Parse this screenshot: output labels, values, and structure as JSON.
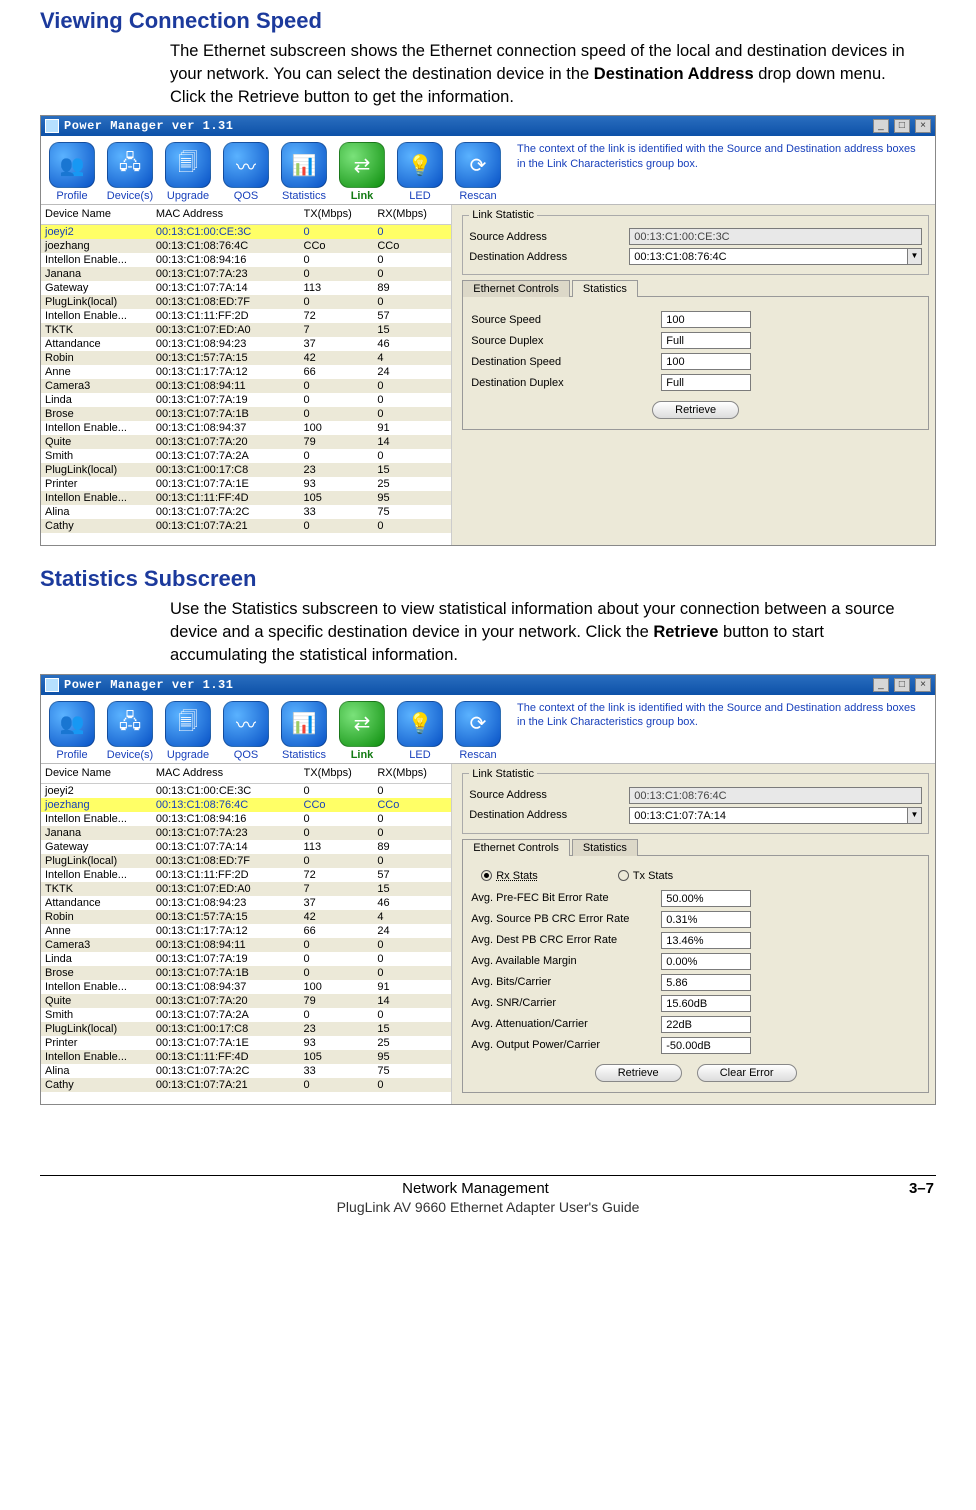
{
  "section1": {
    "title": "Viewing Connection Speed",
    "para_parts": {
      "p1": "The Ethernet subscreen shows the Ethernet connection speed of the local and destination devices in your network. You can select the destination device in the ",
      "bold1": "Destination Address",
      "p2": " drop down menu. Click the Retrieve button to get the information."
    }
  },
  "section2": {
    "title": "Statistics Subscreen",
    "para_parts": {
      "p1": "Use the Statistics subscreen to view statistical information about your connection between a source device and a specific destination device in your network.   Click the ",
      "bold1": "Retrieve",
      "p2": " button to start accumulating the statistical information."
    }
  },
  "window": {
    "title": "Power Manager ver 1.31",
    "context_help": "The context of the link is identified with the Source and Destination address boxes in the Link Characteristics group box.",
    "toolbar": [
      {
        "label": "Profile",
        "c1": "#5ab2ff",
        "c2": "#0852c6",
        "glyph": "👥"
      },
      {
        "label": "Device(s)",
        "c1": "#5ab2ff",
        "c2": "#0852c6",
        "glyph": "🖧"
      },
      {
        "label": "Upgrade",
        "c1": "#5ab2ff",
        "c2": "#0852c6",
        "glyph": "🗐"
      },
      {
        "label": "QOS",
        "c1": "#5ab2ff",
        "c2": "#0852c6",
        "glyph": "〰"
      },
      {
        "label": "Statistics",
        "c1": "#5ab2ff",
        "c2": "#0852c6",
        "glyph": "📊"
      },
      {
        "label": "Link",
        "c1": "#7ae27a",
        "c2": "#0e8f0e",
        "glyph": "⇄"
      },
      {
        "label": "LED",
        "c1": "#5ab2ff",
        "c2": "#0852c6",
        "glyph": "💡"
      },
      {
        "label": "Rescan",
        "c1": "#5ab2ff",
        "c2": "#0852c6",
        "glyph": "⟳"
      }
    ],
    "columns": {
      "name": "Device Name",
      "mac": "MAC Address",
      "tx": "TX(Mbps)",
      "rx": "RX(Mbps)"
    },
    "devices": [
      {
        "name": "joeyi2",
        "mac": "00:13:C1:00:CE:3C",
        "tx": "0",
        "rx": "0"
      },
      {
        "name": "joezhang",
        "mac": "00:13:C1:08:76:4C",
        "tx": "CCo",
        "rx": "CCo"
      },
      {
        "name": "Intellon Enable...",
        "mac": "00:13:C1:08:94:16",
        "tx": "0",
        "rx": "0"
      },
      {
        "name": "Janana",
        "mac": "00:13:C1:07:7A:23",
        "tx": "0",
        "rx": "0"
      },
      {
        "name": "Gateway",
        "mac": "00:13:C1:07:7A:14",
        "tx": "113",
        "rx": "89"
      },
      {
        "name": "PlugLink(local)",
        "mac": "00:13:C1:08:ED:7F",
        "tx": "0",
        "rx": "0"
      },
      {
        "name": "Intellon Enable...",
        "mac": "00:13:C1:11:FF:2D",
        "tx": "72",
        "rx": "57"
      },
      {
        "name": "TKTK",
        "mac": "00:13:C1:07:ED:A0",
        "tx": "7",
        "rx": "15"
      },
      {
        "name": "Attandance",
        "mac": "00:13:C1:08:94:23",
        "tx": "37",
        "rx": "46"
      },
      {
        "name": "Robin",
        "mac": "00:13:C1:57:7A:15",
        "tx": "42",
        "rx": "4"
      },
      {
        "name": "Anne",
        "mac": "00:13:C1:17:7A:12",
        "tx": "66",
        "rx": "24"
      },
      {
        "name": "Camera3",
        "mac": "00:13:C1:08:94:11",
        "tx": "0",
        "rx": "0"
      },
      {
        "name": "Linda",
        "mac": "00:13:C1:07:7A:19",
        "tx": "0",
        "rx": "0"
      },
      {
        "name": "Brose",
        "mac": "00:13:C1:07:7A:1B",
        "tx": "0",
        "rx": "0"
      },
      {
        "name": "Intellon Enable...",
        "mac": "00:13:C1:08:94:37",
        "tx": "100",
        "rx": "91"
      },
      {
        "name": "Quite",
        "mac": "00:13:C1:07:7A:20",
        "tx": "79",
        "rx": "14"
      },
      {
        "name": "Smith",
        "mac": "00:13:C1:07:7A:2A",
        "tx": "0",
        "rx": "0"
      },
      {
        "name": "PlugLink(local)",
        "mac": "00:13:C1:00:17:C8",
        "tx": "23",
        "rx": "15"
      },
      {
        "name": "Printer",
        "mac": "00:13:C1:07:7A:1E",
        "tx": "93",
        "rx": "25"
      },
      {
        "name": "Intellon Enable...",
        "mac": "00:13:C1:11:FF:4D",
        "tx": "105",
        "rx": "95"
      },
      {
        "name": "Alina",
        "mac": "00:13:C1:07:7A:2C",
        "tx": "33",
        "rx": "75"
      },
      {
        "name": "Cathy",
        "mac": "00:13:C1:07:7A:21",
        "tx": "0",
        "rx": "0"
      }
    ]
  },
  "screen1": {
    "selected_row": 0,
    "link_stat_legend": "Link Statistic",
    "src_label": "Source Address",
    "dst_label": "Destination Address",
    "src_val": "00:13:C1:00:CE:3C",
    "dst_val": "00:13:C1:08:76:4C",
    "tab_eth": "Ethernet Controls",
    "tab_stats": "Statistics",
    "eth_rows": [
      {
        "label": "Source Speed",
        "val": "100"
      },
      {
        "label": "Source Duplex",
        "val": "Full"
      },
      {
        "label": "Destination Speed",
        "val": "100"
      },
      {
        "label": "Destination Duplex",
        "val": "Full"
      }
    ],
    "retrieve": "Retrieve"
  },
  "screen2": {
    "selected_row": 1,
    "link_stat_legend": "Link Statistic",
    "src_label": "Source Address",
    "dst_label": "Destination Address",
    "src_val": "00:13:C1:08:76:4C",
    "dst_val": "00:13:C1:07:7A:14",
    "tab_eth": "Ethernet Controls",
    "tab_stats": "Statistics",
    "radio_rx": "Rx Stats",
    "radio_tx": "Tx Stats",
    "stat_rows": [
      {
        "label": "Avg. Pre-FEC Bit Error Rate",
        "val": "50.00%"
      },
      {
        "label": "Avg. Source PB CRC Error Rate",
        "val": "0.31%"
      },
      {
        "label": "Avg. Dest PB CRC Error Rate",
        "val": "13.46%"
      },
      {
        "label": "Avg. Available Margin",
        "val": "0.00%"
      },
      {
        "label": "Avg. Bits/Carrier",
        "val": "5.86"
      },
      {
        "label": "Avg. SNR/Carrier",
        "val": "15.60dB"
      },
      {
        "label": "Avg. Attenuation/Carrier",
        "val": "22dB"
      },
      {
        "label": "Avg. Output Power/Carrier",
        "val": "-50.00dB"
      }
    ],
    "retrieve": "Retrieve",
    "clear": "Clear Error"
  },
  "footer": {
    "mid": "Network Management",
    "right": "3–7",
    "sub": "PlugLink AV 9660 Ethernet Adapter User's Guide"
  }
}
